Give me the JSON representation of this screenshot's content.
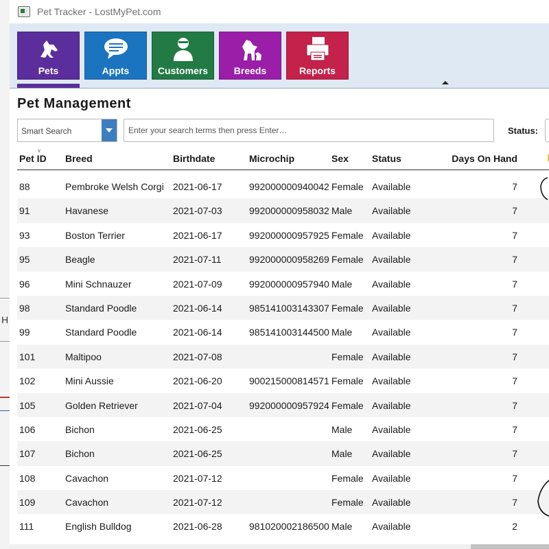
{
  "window": {
    "title": "Pet Tracker - LostMyPet.com"
  },
  "background_window": {
    "partial_letter": "H"
  },
  "nav": [
    {
      "key": "pets",
      "label": "Pets",
      "icon": "dog-icon",
      "color": "#5b2e9b",
      "active": true
    },
    {
      "key": "appts",
      "label": "Appts",
      "icon": "speech-bubble-icon",
      "color": "#1b74c0"
    },
    {
      "key": "customers",
      "label": "Customers",
      "icon": "person-icon",
      "color": "#227a44"
    },
    {
      "key": "breeds",
      "label": "Breeds",
      "icon": "dog-breeds-icon",
      "color": "#9a1ea8"
    },
    {
      "key": "reports",
      "label": "Reports",
      "icon": "printer-icon",
      "color": "#c4214b"
    }
  ],
  "page": {
    "title": "Pet  Management"
  },
  "search": {
    "mode": "Smart Search",
    "placeholder": "Enter your search terms then press Enter…",
    "status_label": "Status:"
  },
  "grid": {
    "columns": [
      "Pet ID",
      "Breed",
      "Birthdate",
      "Microchip",
      "Sex",
      "Status",
      "Days On Hand"
    ],
    "rows": [
      [
        "88",
        "Pembroke Welsh Corgi",
        "2021-06-17",
        "992000000940042",
        "Female",
        "Available",
        "7"
      ],
      [
        "91",
        "Havanese",
        "2021-07-03",
        "992000000958032",
        "Male",
        "Available",
        "7"
      ],
      [
        "93",
        "Boston Terrier",
        "2021-06-17",
        "992000000957925",
        "Female",
        "Available",
        "7"
      ],
      [
        "95",
        "Beagle",
        "2021-07-11",
        "992000000958269",
        "Female",
        "Available",
        "7"
      ],
      [
        "96",
        "Mini Schnauzer",
        "2021-07-09",
        "992000000957940",
        "Male",
        "Available",
        "7"
      ],
      [
        "98",
        "Standard Poodle",
        "2021-06-14",
        "985141003143307",
        "Female",
        "Available",
        "7"
      ],
      [
        "99",
        "Standard Poodle",
        "2021-06-14",
        "985141003144500",
        "Male",
        "Available",
        "7"
      ],
      [
        "101",
        "Maltipoo",
        "2021-07-08",
        "",
        "Female",
        "Available",
        "7"
      ],
      [
        "102",
        "Mini Aussie",
        "2021-06-20",
        "900215000814571",
        "Female",
        "Available",
        "7"
      ],
      [
        "105",
        "Golden Retriever",
        "2021-07-04",
        "992000000957924",
        "Female",
        "Available",
        "7"
      ],
      [
        "106",
        "Bichon",
        "2021-06-25",
        "",
        "Male",
        "Available",
        "7"
      ],
      [
        "107",
        "Bichon",
        "2021-06-25",
        "",
        "Male",
        "Available",
        "7"
      ],
      [
        "108",
        "Cavachon",
        "2021-07-12",
        "",
        "Female",
        "Available",
        "7"
      ],
      [
        "109",
        "Cavachon",
        "2021-07-12",
        "",
        "Female",
        "Available",
        "7"
      ],
      [
        "111",
        "English Bulldog",
        "2021-06-28",
        "981020002186500",
        "Male",
        "Available",
        "2"
      ]
    ]
  }
}
